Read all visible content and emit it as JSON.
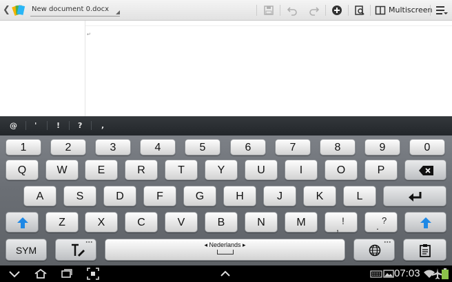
{
  "toolbar": {
    "title": "New document 0.docx",
    "multiscreen_label": "Multiscreen",
    "icons": [
      "back-icon",
      "app-logo-icon",
      "save-icon",
      "undo-icon",
      "redo-icon",
      "insert-icon",
      "view-icon",
      "multiscreen-icon",
      "menu-icon"
    ]
  },
  "document": {
    "cursor_mark": "↵"
  },
  "suggestions": [
    "@",
    "'",
    "!",
    "?",
    ","
  ],
  "keyboard": {
    "number_row": [
      "1",
      "2",
      "3",
      "4",
      "5",
      "6",
      "7",
      "8",
      "9",
      "0"
    ],
    "row1": [
      "Q",
      "W",
      "E",
      "R",
      "T",
      "Y",
      "U",
      "I",
      "O",
      "P"
    ],
    "row2": [
      "A",
      "S",
      "D",
      "F",
      "G",
      "H",
      "J",
      "K",
      "L"
    ],
    "row3": [
      "Z",
      "X",
      "C",
      "V",
      "B",
      "N",
      "M"
    ],
    "row3_punct": [
      {
        "main": ",",
        "alt": "!"
      },
      {
        "main": ".",
        "alt": "?"
      }
    ],
    "sym_label": "SYM",
    "space_label": "Nederlands",
    "accent_color": "#1e88e5"
  },
  "navbar": {
    "time": "07:03",
    "icons": [
      "hide-keyboard-icon",
      "home-icon",
      "recent-apps-icon",
      "screenshot-icon",
      "up-chevron-icon",
      "keyboard-status-icon",
      "picture-icon",
      "wifi-icon",
      "airplane-icon",
      "battery-icon"
    ]
  }
}
